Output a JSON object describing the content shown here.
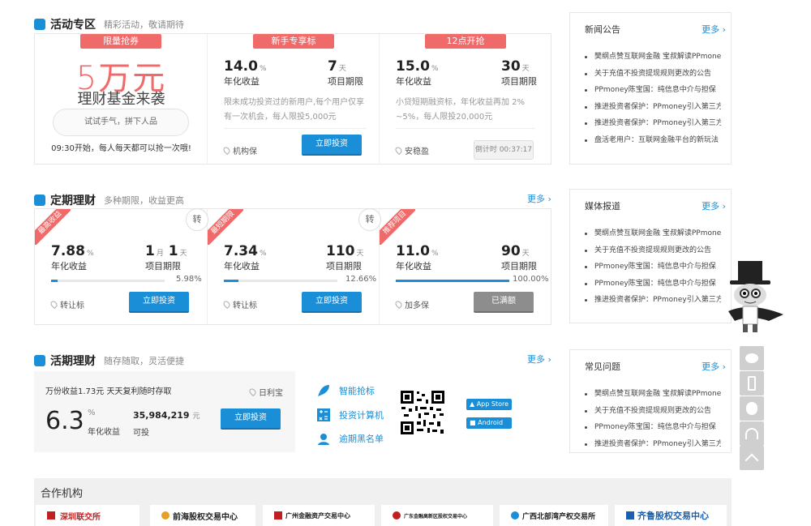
{
  "activity": {
    "title": "活动专区",
    "subtitle": "精彩活动，敬请期待",
    "promo": {
      "ribbon": "限量抢券",
      "big": "5万元",
      "sub": "理财基金来袭",
      "btn": "试试手气，拼下人品",
      "note": "09:30开始，每人每天都可以抢一次哦!"
    },
    "cards": [
      {
        "ribbon": "新手专享标",
        "rate": "14.0",
        "rate_unit": "%",
        "rate_label": "年化收益",
        "term": "7",
        "term_unit": "天",
        "term_label": "项目期限",
        "desc": "限未成功投资过的新用户,每个用户仅享有一次机会，每人限投5,000元",
        "loc": "机构保",
        "btn": "立即投资"
      },
      {
        "ribbon": "12点开抢",
        "rate": "15.0",
        "rate_unit": "%",
        "rate_label": "年化收益",
        "term": "30",
        "term_unit": "天",
        "term_label": "项目期限",
        "desc": "小贷短期融资标，年化收益再加 2% ~5%，每人限投20,000元",
        "loc": "安稳盈",
        "btn": "倒计时 00:37:17"
      }
    ]
  },
  "fixed": {
    "title": "定期理财",
    "subtitle": "多种期限，收益更高",
    "more": "更多",
    "cards": [
      {
        "tag": "最高收益",
        "zhuan": "转",
        "rate": "7.88",
        "rate_unit": "%",
        "rate_label": "年化收益",
        "term_a": "1",
        "term_a_unit": "月",
        "term_b": "1",
        "term_b_unit": "天",
        "term_label": "项目期限",
        "progress": 5.98,
        "pct": "5.98%",
        "loc": "转让标",
        "btn": "立即投资"
      },
      {
        "tag": "最短期限",
        "zhuan": "转",
        "rate": "7.34",
        "rate_unit": "%",
        "rate_label": "年化收益",
        "term": "110",
        "term_unit": "天",
        "term_label": "项目期限",
        "progress": 12.66,
        "pct": "12.66%",
        "loc": "转让标",
        "btn": "立即投资"
      },
      {
        "tag": "推荐项目",
        "rate": "11.0",
        "rate_unit": "%",
        "rate_label": "年化收益",
        "term": "90",
        "term_unit": "天",
        "term_label": "项目期限",
        "progress": 100,
        "pct": "100.00%",
        "loc": "加多保",
        "btn": "已满额"
      }
    ]
  },
  "current": {
    "title": "活期理财",
    "subtitle": "随存随取，灵活便捷",
    "more": "更多",
    "headline": "万份收益1.73元 天天复利随时存取",
    "loc": "日利宝",
    "rate": "6.3",
    "rate_unit": "%",
    "rate_label": "年化收益",
    "amount": "35,984,219",
    "amount_unit": "元",
    "amount_label": "可投",
    "btn": "立即投资",
    "tools": [
      "智能抢标",
      "投资计算机",
      "逾期黑名单"
    ],
    "app_store": "App Store",
    "android": "Android"
  },
  "news": {
    "title": "新闻公告",
    "more": "更多",
    "items": [
      "樊纲点赞互联网金融 宝叔解读PPmoney",
      "关于充值不投资提现规则更改的公告",
      "PPmoney陈宝国：纯信息中介与担保",
      "推进投资者保护：PPmoney引入第三方",
      "推进投资者保护：PPmoney引入第三方",
      "盘活老用户：互联网金融平台的新玩法"
    ]
  },
  "media": {
    "title": "媒体报道",
    "more": "更多",
    "items": [
      "樊纲点赞互联网金融 宝叔解读PPmoney",
      "关于充值不投资提现规则更改的公告",
      "PPmoney陈宝国：纯信息中介与担保",
      "PPmoney陈宝国：纯信息中介与担保",
      "推进投资者保护：PPmoney引入第三方"
    ]
  },
  "faq": {
    "title": "常见问题",
    "more": "更多",
    "items": [
      "樊纲点赞互联网金融 宝叔解读PPmoney",
      "关于充值不投资提现规则更改的公告",
      "PPmoney陈宝国：纯信息中介与担保",
      "推进投资者保护：PPmoney引入第三方"
    ]
  },
  "partners": {
    "title": "合作机构",
    "items": [
      "深圳联交所",
      "前海股权交易中心",
      "广州金融资产交易中心",
      "广东金融高新区股权交易中心",
      "广西北部湾产权交易所",
      "齐鲁股权交易中心"
    ]
  },
  "colors": {
    "accent": "#1a8fd8",
    "ribbon": "#f06a6a"
  }
}
